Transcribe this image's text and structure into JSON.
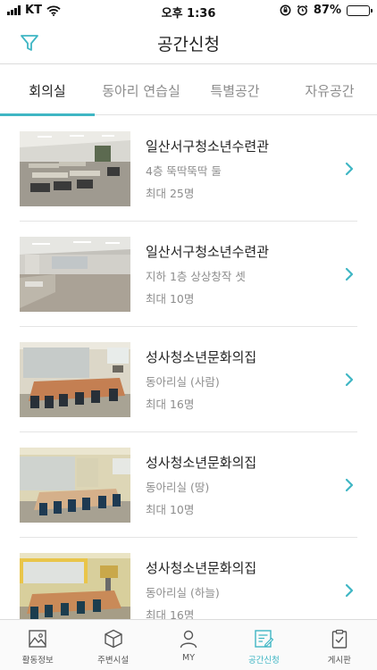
{
  "status_bar": {
    "carrier": "KT",
    "time": "오후 1:36",
    "battery_percent": "87%",
    "battery_level": 0.87
  },
  "header": {
    "title": "공간신청",
    "filter_icon": "filter-icon"
  },
  "tabs": [
    {
      "label": "회의실",
      "active": true
    },
    {
      "label": "동아리 연습실",
      "active": false
    },
    {
      "label": "특별공간",
      "active": false
    },
    {
      "label": "자유공간",
      "active": false
    }
  ],
  "rooms": [
    {
      "venue": "일산서구청소년수련관",
      "room": "4층 뚝딱뚝딱 둘",
      "capacity": "최대 25명"
    },
    {
      "venue": "일산서구청소년수련관",
      "room": "지하 1층 상상창작 셋",
      "capacity": "최대 10명"
    },
    {
      "venue": "성사청소년문화의집",
      "room": "동아리실 (사람)",
      "capacity": "최대 16명"
    },
    {
      "venue": "성사청소년문화의집",
      "room": "동아리실 (땅)",
      "capacity": "최대 10명"
    },
    {
      "venue": "성사청소년문화의집",
      "room": "동아리실 (하늘)",
      "capacity": "최대 16명"
    }
  ],
  "bottom_nav": [
    {
      "label": "활동정보",
      "icon": "photo-icon",
      "active": false
    },
    {
      "label": "주변시설",
      "icon": "cube-icon",
      "active": false
    },
    {
      "label": "MY",
      "icon": "person-icon",
      "active": false
    },
    {
      "label": "공간신청",
      "icon": "apply-document-icon",
      "active": true
    },
    {
      "label": "게시판",
      "icon": "clipboard-icon",
      "active": false
    }
  ],
  "colors": {
    "accent": "#3fb6c4",
    "text": "#222222",
    "muted": "#8d8d8d"
  }
}
